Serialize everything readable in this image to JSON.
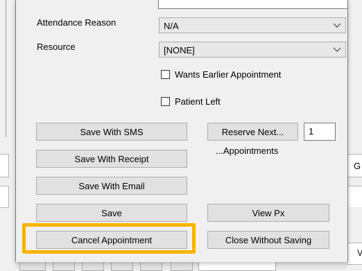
{
  "form": {
    "attendance_reason_label": "Attendance Reason",
    "attendance_reason_value": "N/A",
    "resource_label": "Resource",
    "resource_value": "[NONE]",
    "wants_earlier_label": "Wants Earlier Appointment",
    "wants_earlier_checked": false,
    "patient_left_label": "Patient Left",
    "patient_left_checked": false
  },
  "buttons": {
    "save_with_sms": "Save With SMS",
    "save_with_receipt": "Save With Receipt",
    "save_with_email": "Save With Email",
    "save": "Save",
    "cancel_appointment": "Cancel Appointment",
    "reserve_next": "Reserve Next...",
    "reserve_count": "1",
    "appointments_caption": "...Appointments",
    "view_px": "View Px",
    "close_without_saving": "Close Without Saving"
  },
  "background": {
    "right_text_top": "G",
    "right_text_bottom": "V"
  },
  "colors": {
    "highlight": "#f7b500",
    "button_face": "#e1e1e1",
    "dialog_bg": "#f0f0f0"
  },
  "icons": {
    "combo_chevron": "chevron-down-icon"
  }
}
